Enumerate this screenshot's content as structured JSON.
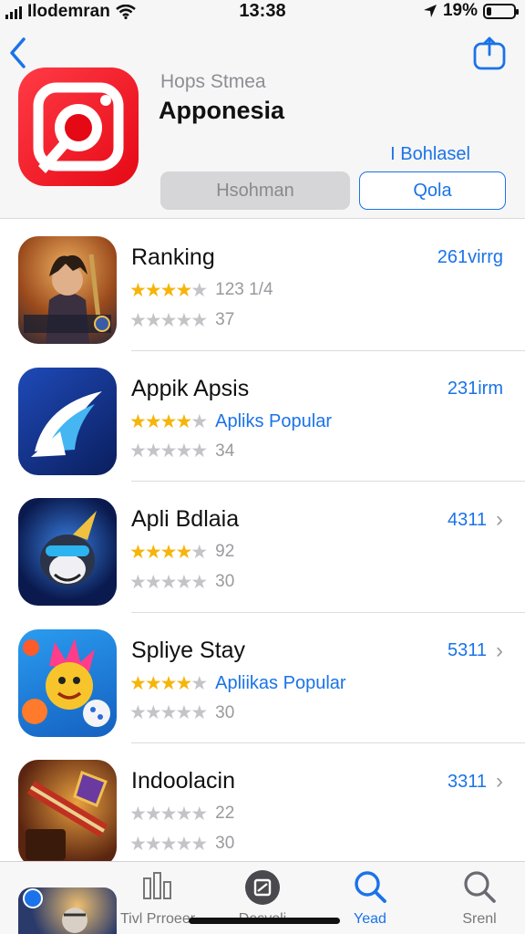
{
  "status_bar": {
    "carrier": "Ilodemran",
    "time": "13:38",
    "battery": "19%",
    "battery_level": 0.19
  },
  "header": {
    "subtitle": "Hops Stmea",
    "title": "Apponesia",
    "link": "I Bohlasel",
    "button_grey": "Hsohman",
    "button_outline": "Qola",
    "icons": {
      "back": "chevron-left-icon",
      "share": "share-icon"
    }
  },
  "apps": [
    {
      "title": "Ranking",
      "meta": "261virrg",
      "has_chevron": false,
      "line1": {
        "rating": 4.5,
        "text": "123 1/4",
        "style": "grey"
      },
      "line2": {
        "rating": 0,
        "text": "37",
        "style": "grey"
      },
      "icon": "warrior-game-icon",
      "colors": [
        "#2c3a5a",
        "#c97a2c"
      ]
    },
    {
      "title": "Appik Apsis",
      "meta": "231irm",
      "has_chevron": false,
      "line1": {
        "rating": 4,
        "text": "Apliks Popular",
        "style": "blue"
      },
      "line2": {
        "rating": 0,
        "text": "34",
        "style": "grey"
      },
      "icon": "swoosh-app-icon",
      "colors": [
        "#0f2f8a",
        "#3bb2f0"
      ]
    },
    {
      "title": "Apli Bdlaia",
      "meta": "4311",
      "has_chevron": true,
      "line1": {
        "rating": 4,
        "text": "92",
        "style": "grey"
      },
      "line2": {
        "rating": 0,
        "text": "30",
        "style": "grey"
      },
      "icon": "bird-game-icon",
      "colors": [
        "#0b1e57",
        "#3b7be0"
      ]
    },
    {
      "title": "Spliye Stay",
      "meta": "5311",
      "has_chevron": true,
      "line1": {
        "rating": 4,
        "text": "Apliikas Popular",
        "style": "blue"
      },
      "line2": {
        "rating": 0,
        "text": "30",
        "style": "grey"
      },
      "icon": "monster-game-icon",
      "colors": [
        "#1a8de0",
        "#f7c52b"
      ]
    },
    {
      "title": "Indoolacin",
      "meta": "3311",
      "has_chevron": true,
      "line1": {
        "rating": 0,
        "text": "22",
        "style": "grey"
      },
      "line2": {
        "rating": 0,
        "text": "30",
        "style": "grey"
      },
      "icon": "sword-game-icon",
      "colors": [
        "#4a1d0c",
        "#d9892a"
      ]
    }
  ],
  "tabbar": {
    "tabs": [
      {
        "label": "Tivl Prroeer",
        "icon": "charts-icon",
        "active": false
      },
      {
        "label": "Desvoli",
        "icon": "profile-icon",
        "active": false
      },
      {
        "label": "Yead",
        "icon": "search-icon",
        "active": true
      },
      {
        "label": "Srenl",
        "icon": "search-icon",
        "active": false
      }
    ]
  },
  "colors": {
    "accent": "#1a73e8",
    "star": "#f5b50a",
    "star_empty": "#c4c4c8",
    "brand_red": "#e50915"
  }
}
